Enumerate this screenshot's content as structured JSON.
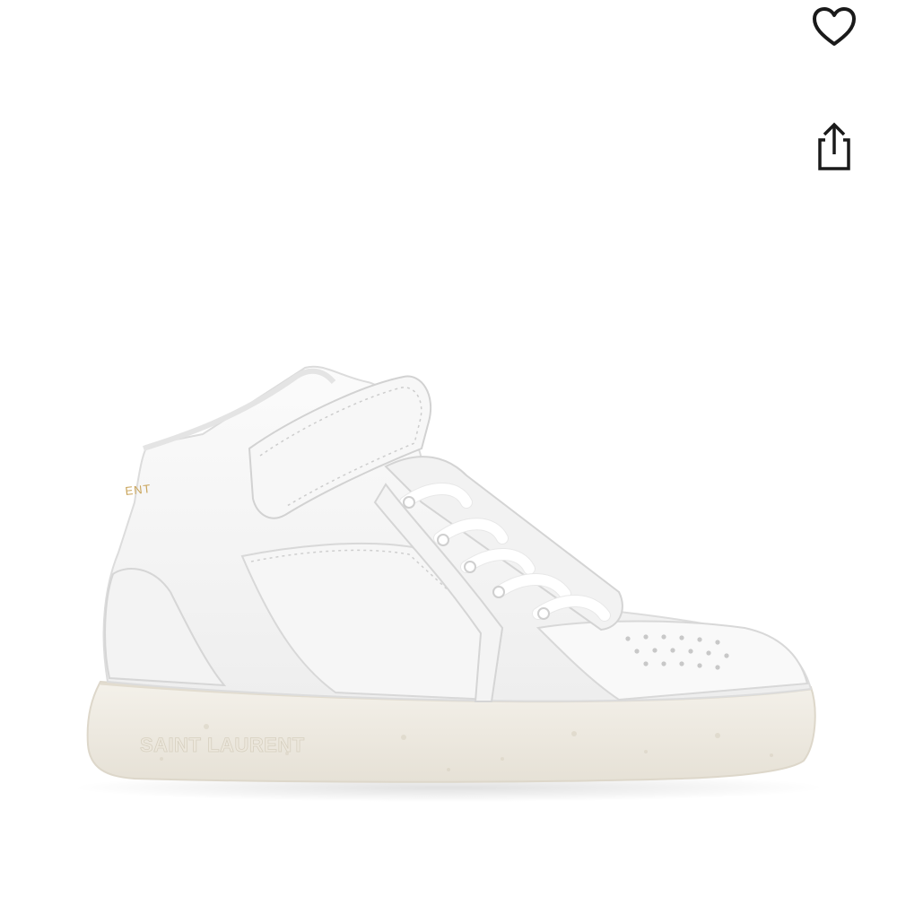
{
  "product": {
    "sole_brand_text": "SAINT LAURENT",
    "collar_brand_text": "ENT"
  },
  "actions": {
    "wishlist_icon": "heart-icon",
    "share_icon": "share-icon"
  },
  "colors": {
    "background": "#ffffff",
    "icon": "#1a1a1a",
    "leather": "#f7f7f7",
    "sole": "#efebe2",
    "logo_gold": "#c9a45a"
  }
}
